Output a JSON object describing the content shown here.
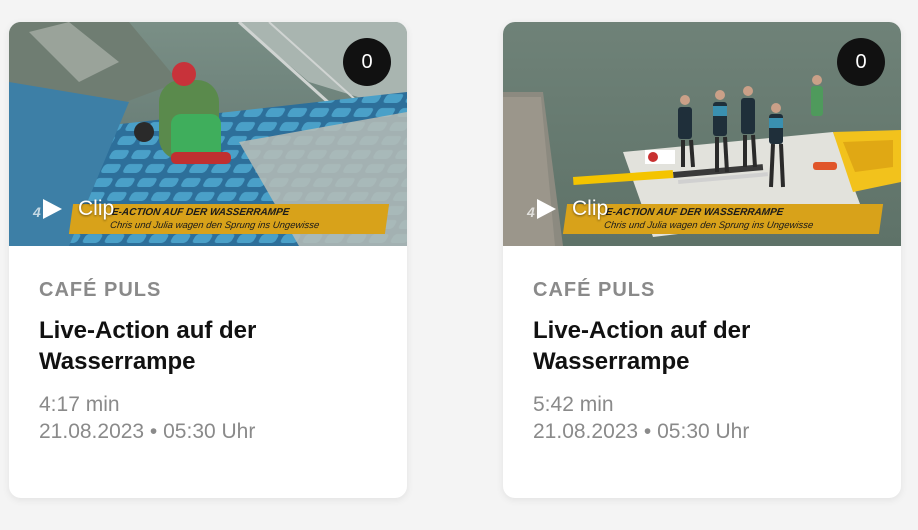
{
  "cards": [
    {
      "badge_count": "0",
      "clip_label": "Clip",
      "overlay_line1": "E-ACTION AUF DER WASSERRAMPE",
      "overlay_line2": "Chris und Julia wagen den Sprung ins Ungewisse",
      "station_logo": "4",
      "category": "CAFÉ PULS",
      "title": "Live-Action auf der Wasserrampe",
      "duration": "4:17 min",
      "date_time": "21.08.2023 • 05:30 Uhr"
    },
    {
      "badge_count": "0",
      "clip_label": "Clip",
      "overlay_line1": "E-ACTION AUF DER WASSERRAMPE",
      "overlay_line2": "Chris und Julia wagen den Sprung ins Ungewisse",
      "station_logo": "4",
      "category": "CAFÉ PULS",
      "title": "Live-Action auf der Wasserrampe",
      "duration": "5:42 min",
      "date_time": "21.08.2023 • 05:30 Uhr"
    }
  ],
  "colors": {
    "accent_yellow": "#d8a21a",
    "badge_bg": "#111111",
    "muted_text": "#8a8a8a",
    "title_text": "#111111"
  }
}
